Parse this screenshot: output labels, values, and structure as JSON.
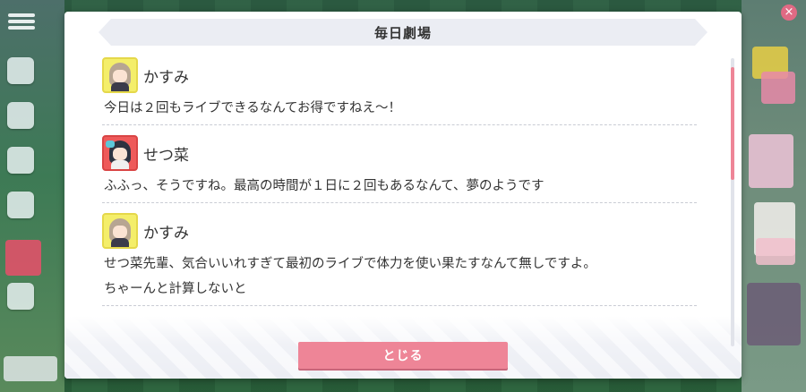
{
  "dialog": {
    "title": "毎日劇場",
    "close_label": "とじる"
  },
  "entries": [
    {
      "speaker": "かすみ",
      "avatar": "kasumi-avatar",
      "lines": [
        "今日は２回もライブできるなんてお得ですねえ〜！"
      ]
    },
    {
      "speaker": "せつ菜",
      "avatar": "setsuna-avatar",
      "lines": [
        "ふふっ、そうですね。最高の時間が１日に２回もあるなんて、夢のようです"
      ]
    },
    {
      "speaker": "かすみ",
      "avatar": "kasumi-avatar",
      "lines": [
        "せつ菜先輩、気合いいれすぎて最初のライブで体力を使い果たすなんて無しですよ。",
        "ちゃーんと計算しないと"
      ]
    }
  ],
  "colors": {
    "accent": "#ee8597",
    "title_band": "#ebedf3",
    "kasumi_frame": "#f4ee6a",
    "setsuna_frame": "#ee5a5a"
  }
}
